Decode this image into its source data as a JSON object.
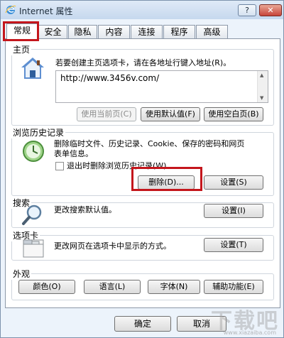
{
  "window": {
    "title": "Internet 属性",
    "help_label": "?",
    "close_label": "✕"
  },
  "tabs": [
    {
      "label": "常规",
      "active": true
    },
    {
      "label": "安全"
    },
    {
      "label": "隐私"
    },
    {
      "label": "内容"
    },
    {
      "label": "连接"
    },
    {
      "label": "程序"
    },
    {
      "label": "高级"
    }
  ],
  "homepage": {
    "group_label": "主页",
    "description": "若要创建主页选项卡，请在各地址行键入地址(R)。",
    "url": "http://www.3456v.com/",
    "use_current": "使用当前页(C)",
    "use_default": "使用默认值(F)",
    "use_blank": "使用空白页(B)"
  },
  "history": {
    "group_label": "浏览历史记录",
    "description_line1": "删除临时文件、历史记录、Cookie、保存的密码和网页",
    "description_line2": "表单信息。",
    "checkbox_label": "退出时删除浏览历史记录(W)",
    "delete_button": "删除(D)...",
    "settings_button": "设置(S)"
  },
  "search": {
    "group_label": "搜索",
    "description": "更改搜索默认值。",
    "settings_button": "设置(I)"
  },
  "tabs_section": {
    "group_label": "选项卡",
    "description": "更改网页在选项卡中显示的方式。",
    "settings_button": "设置(T)"
  },
  "appearance": {
    "group_label": "外观",
    "colors": "颜色(O)",
    "languages": "语言(L)",
    "fonts": "字体(N)",
    "accessibility": "辅助功能(E)"
  },
  "footer": {
    "ok": "确定",
    "cancel": "取消"
  },
  "watermark": {
    "text": "下载吧",
    "url": "www.xiazaiba.com"
  },
  "colors": {
    "highlight": "#c4161c"
  }
}
